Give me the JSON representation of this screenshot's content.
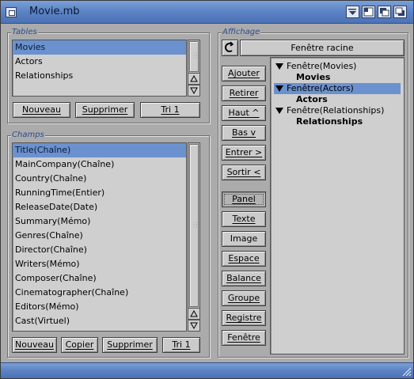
{
  "window": {
    "title": "Movie.mb"
  },
  "tables": {
    "label": "Tables",
    "items": [
      "Movies",
      "Actors",
      "Relationships"
    ],
    "selected_index": 0,
    "buttons": {
      "new": "Nouveau",
      "delete": "Supprimer",
      "sort": "Tri 1"
    }
  },
  "fields": {
    "label": "Champs",
    "items": [
      "Title(Chaîne)",
      "MainCompany(Chaîne)",
      "Country(Chaîne)",
      "RunningTime(Entier)",
      "ReleaseDate(Date)",
      "Summary(Mémo)",
      "Genres(Chaîne)",
      "Director(Chaîne)",
      "Writers(Mémo)",
      "Composer(Chaîne)",
      "Cinematographer(Chaîne)",
      "Editors(Mémo)",
      "Cast(Virtuel)"
    ],
    "selected_index": 0,
    "buttons": {
      "new": "Nouveau",
      "copy": "Copier",
      "delete": "Supprimer",
      "sort": "Tri 1"
    }
  },
  "display": {
    "label": "Affichage",
    "cycle_value": "Fenêtre racine",
    "actions": [
      "Ajouter",
      "Retirer",
      "Haut ^",
      "Bas v",
      "Entrer >",
      "Sortir <"
    ],
    "objects": [
      "Panel",
      "Texte",
      "Image",
      "Espace",
      "Balance",
      "Groupe",
      "Registre",
      "Fenêtre"
    ],
    "tree": [
      {
        "label": "Fenêtre(Movies)",
        "child": "Movies",
        "selected": false
      },
      {
        "label": "Fenêtre(Actors)",
        "child": "Actors",
        "selected": true
      },
      {
        "label": "Fenêtre(Relationships)",
        "child": "Relationships",
        "selected": false
      }
    ]
  },
  "colors": {
    "title_bar": "#5b82c4",
    "selection": "#6b91cf",
    "window_bg": "#ababab"
  },
  "icons": [
    "close-icon",
    "iconify-icon",
    "zoom-icon",
    "depth-back-icon",
    "depth-front-icon",
    "cycle-icon",
    "scroll-up-icon",
    "scroll-down-icon",
    "tree-expanded-icon",
    "resize-grip-icon"
  ]
}
